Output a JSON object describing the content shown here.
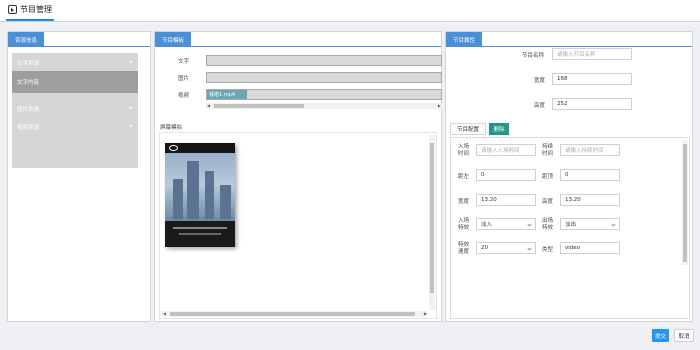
{
  "app": {
    "title": "节目管理",
    "icon": "play-square-icon"
  },
  "resource_panel": {
    "tab": "资源信息",
    "menu": [
      {
        "label": "文字资源"
      },
      {
        "label": "文字内容"
      },
      {
        "label": "图片资源"
      },
      {
        "label": "视频资源"
      }
    ]
  },
  "program_panel": {
    "tab": "节目模板",
    "fields": {
      "text_label": "文字",
      "image_label": "图片",
      "video_label": "视频",
      "video_value": "铁塔1.mp4"
    },
    "preview_label": "屏幕模拟"
  },
  "attr_panel": {
    "tab": "节目属性",
    "name_label": "节目名称",
    "name_placeholder": "请输入节目名称",
    "width_label": "宽度",
    "width_value": "168",
    "height_label": "高度",
    "height_value": "252",
    "config_tab": "节目配置",
    "delete_label": "删除",
    "config": {
      "enter_time_label": "入场时间",
      "enter_time_placeholder": "请输入入场时间",
      "duration_label": "持续时间",
      "duration_placeholder": "请输入持续时间",
      "left_label": "距左",
      "left_value": "0",
      "top_label": "距顶",
      "top_value": "0",
      "width_label": "宽度",
      "width_value": "13.20",
      "height_label": "高度",
      "height_value": "13.20",
      "enter_effect_label": "入场特效",
      "enter_effect_value": "淡入",
      "exit_effect_label": "出场特效",
      "exit_effect_value": "淡出",
      "effect_speed_label": "特效速度",
      "effect_speed_value": "20",
      "type_label": "类型",
      "type_value": "video"
    }
  },
  "footer": {
    "submit": "提交",
    "cancel": "取消"
  },
  "colors": {
    "accent": "#4a90d9",
    "teal": "#1f9a8a",
    "submit": "#2196f3"
  }
}
